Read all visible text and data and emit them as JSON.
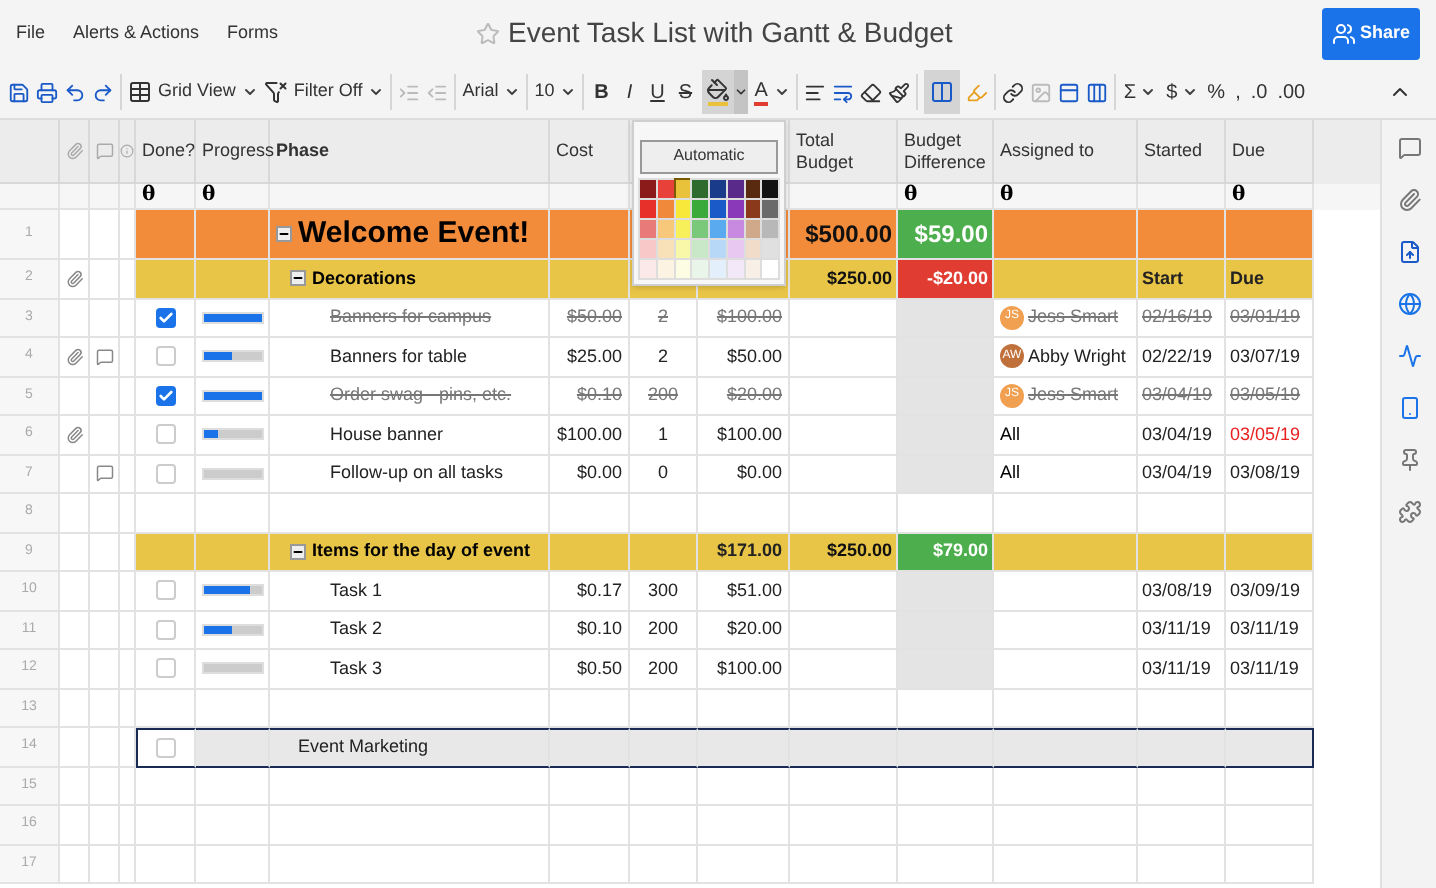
{
  "menu": [
    "File",
    "Alerts & Actions",
    "Forms"
  ],
  "title": "Event Task List with Gantt & Budget",
  "share": "Share",
  "toolbar": {
    "view": "Grid View",
    "filter": "Filter Off",
    "font": "Arial",
    "size": "10",
    "styles": [
      "B",
      "I",
      "U",
      "S"
    ],
    "fill_active": true,
    "font_color": "A",
    "highlight_active": true,
    "number_formats": [
      {
        "label": "Σ",
        "menu": true
      },
      {
        "label": "$",
        "menu": true
      },
      {
        "label": "%",
        "menu": false
      },
      {
        "label": ",",
        "menu": false
      },
      {
        "label": ".0",
        "menu": false
      },
      {
        "label": ".00",
        "menu": false
      }
    ]
  },
  "palette": {
    "automatic": "Automatic",
    "swatches": [
      {
        "color": "#8b1a1a",
        "selected": false
      },
      {
        "color": "#e8413a",
        "selected": false
      },
      {
        "color": "#e8c23a",
        "selected": true
      },
      {
        "color": "#2e6b2e",
        "selected": false
      },
      {
        "color": "#1a3a8a",
        "selected": false
      },
      {
        "color": "#5a2a8a",
        "selected": false
      },
      {
        "color": "#5a2a10",
        "selected": false
      },
      {
        "color": "#111111",
        "selected": false
      },
      {
        "color": "#e8302a",
        "selected": false
      },
      {
        "color": "#f08a3a",
        "selected": false
      },
      {
        "color": "#f8e83a",
        "selected": false
      },
      {
        "color": "#3aaa3a",
        "selected": false
      },
      {
        "color": "#1a5ac8",
        "selected": false
      },
      {
        "color": "#8a3ab8",
        "selected": false
      },
      {
        "color": "#8a3a1a",
        "selected": false
      },
      {
        "color": "#6a6a6a",
        "selected": false
      },
      {
        "color": "#e87a7a",
        "selected": false
      },
      {
        "color": "#f8c87a",
        "selected": false
      },
      {
        "color": "#f8f05a",
        "selected": false
      },
      {
        "color": "#7ac87a",
        "selected": false
      },
      {
        "color": "#5aaaf0",
        "selected": false
      },
      {
        "color": "#c88ae0",
        "selected": false
      },
      {
        "color": "#d0a88a",
        "selected": false
      },
      {
        "color": "#b8b8b8",
        "selected": false
      },
      {
        "color": "#f8c8c8",
        "selected": false
      },
      {
        "color": "#f8e0b8",
        "selected": false
      },
      {
        "color": "#f8f8a8",
        "selected": false
      },
      {
        "color": "#c8e8c8",
        "selected": false
      },
      {
        "color": "#b8d8f8",
        "selected": false
      },
      {
        "color": "#e8c8f0",
        "selected": false
      },
      {
        "color": "#f0dcc8",
        "selected": false
      },
      {
        "color": "#e0e0e0",
        "selected": false
      },
      {
        "color": "#fbe8e8",
        "selected": false
      },
      {
        "color": "#fdf3e3",
        "selected": false
      },
      {
        "color": "#fdfde3",
        "selected": false
      },
      {
        "color": "#e8f5e8",
        "selected": false
      },
      {
        "color": "#e3f0fb",
        "selected": false
      },
      {
        "color": "#f3e8f8",
        "selected": false
      },
      {
        "color": "#f8efe6",
        "selected": false
      },
      {
        "color": "#ffffff",
        "selected": false
      }
    ]
  },
  "columns": [
    {
      "label": "Done?",
      "mark": "θ"
    },
    {
      "label": "Progress",
      "mark": "θ"
    },
    {
      "label": "Phase"
    },
    {
      "label": "Cost"
    },
    {},
    {},
    {
      "label": "Total Budget"
    },
    {
      "label": "Budget Difference",
      "mark": "θ"
    },
    {
      "label": "Assigned to",
      "mark": "θ"
    },
    {
      "label": "Started"
    },
    {
      "label": "Due",
      "mark": "θ"
    }
  ],
  "rows": [
    {
      "num": "1",
      "kind": "level1",
      "phase": "Welcome Event!",
      "total_budget": "$500.00",
      "diff": {
        "text": "$59.00",
        "color": "#4cae4c"
      }
    },
    {
      "num": "2",
      "kind": "level2",
      "attachment": true,
      "phase": "Decorations",
      "total_budget": "$250.00",
      "diff": {
        "text": "-$20.00",
        "color": "#e03c31"
      },
      "started": "Start",
      "due": "Due"
    },
    {
      "num": "3",
      "kind": "task",
      "done": true,
      "progress": {
        "level": 1
      },
      "phase": "Banners for campus",
      "struck": true,
      "cost": "$50.00",
      "qty": "2",
      "total": "$100.00",
      "assignee": {
        "initials": "JS",
        "name": "Jess Smart",
        "color": "#f0a050"
      },
      "started": "02/16/19",
      "due": "03/01/19"
    },
    {
      "num": "4",
      "kind": "task",
      "attachment": true,
      "comment": true,
      "done": false,
      "progress": {
        "level": 0.5
      },
      "phase": "Banners for table",
      "struck": false,
      "cost": "$25.00",
      "qty": "2",
      "total": "$50.00",
      "assignee": {
        "initials": "AW",
        "name": "Abby Wright",
        "color": "#c0703a"
      },
      "started": "02/22/19",
      "due": "03/07/19"
    },
    {
      "num": "5",
      "kind": "task",
      "done": true,
      "progress": {
        "level": 1
      },
      "phase": "Order swag - pins, etc.",
      "struck": true,
      "cost": "$0.10",
      "qty": "200",
      "total": "$20.00",
      "assignee": {
        "initials": "JS",
        "name": "Jess Smart",
        "color": "#f0a050"
      },
      "started": "03/04/19",
      "due": "03/05/19"
    },
    {
      "num": "6",
      "kind": "task",
      "attachment": true,
      "done": false,
      "progress": {
        "level": 0.25
      },
      "phase": "House banner",
      "struck": false,
      "cost": "$100.00",
      "qty": "1",
      "total": "$100.00",
      "assigned": "All",
      "started": "03/04/19",
      "due": "03/05/19",
      "due_overdue": true
    },
    {
      "num": "7",
      "kind": "task",
      "comment": true,
      "done": false,
      "progress": {
        "level": 0
      },
      "phase": "Follow-up on all tasks",
      "struck": false,
      "cost": "$0.00",
      "qty": "0",
      "total": "$0.00",
      "assigned": "All",
      "started": "03/04/19",
      "due": "03/08/19"
    },
    {
      "num": "8",
      "kind": "blank"
    },
    {
      "num": "9",
      "kind": "level2",
      "phase": "Items for the day of event",
      "total": "$171.00",
      "total_budget": "$250.00",
      "diff": {
        "text": "$79.00",
        "color": "#4cae4c"
      }
    },
    {
      "num": "10",
      "kind": "task",
      "done": false,
      "progress": {
        "level": 0.8
      },
      "phase": "Task 1",
      "struck": false,
      "cost": "$0.17",
      "qty": "300",
      "total": "$51.00",
      "started": "03/08/19",
      "due": "03/09/19"
    },
    {
      "num": "11",
      "kind": "task",
      "done": false,
      "progress": {
        "level": 0.5
      },
      "phase": "Task 2",
      "struck": false,
      "cost": "$0.10",
      "qty": "200",
      "total": "$20.00",
      "started": "03/11/19",
      "due": "03/11/19"
    },
    {
      "num": "12",
      "kind": "task",
      "done": false,
      "progress": {
        "level": 0
      },
      "phase": "Task 3",
      "struck": false,
      "cost": "$0.50",
      "qty": "200",
      "total": "$100.00",
      "started": "03/11/19",
      "due": "03/11/19"
    },
    {
      "num": "13",
      "kind": "blank"
    },
    {
      "num": "14",
      "kind": "selected",
      "done": false,
      "phase": "Event Marketing"
    },
    {
      "num": "15",
      "kind": "blank"
    },
    {
      "num": "16",
      "kind": "blank"
    },
    {
      "num": "17",
      "kind": "blank"
    }
  ]
}
